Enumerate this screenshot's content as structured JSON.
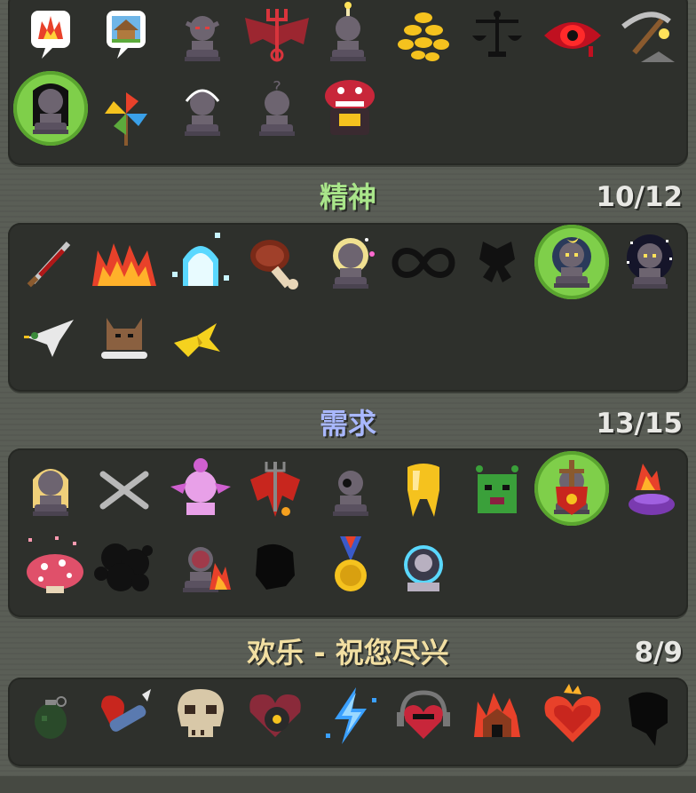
{
  "categories": [
    {
      "title": "",
      "count": "",
      "color": "#ffffff"
    },
    {
      "title": "精神",
      "count": "10/12",
      "color": "#a9e58a"
    },
    {
      "title": "需求",
      "count": "13/15",
      "color": "#a9b8ff"
    },
    {
      "title": "欢乐 - 祝您尽兴",
      "count": "8/9",
      "color": "#f2dfa2"
    }
  ],
  "icons": {
    "row1": [
      "fire-speech-icon",
      "house-speech-icon",
      "statue-demon-icon",
      "devil-wings-trident-icon",
      "statue-candle-icon",
      "gold-coins-icon",
      "scales-icon",
      "red-eye-icon",
      "pickaxe-icon"
    ],
    "row2": [
      "statue-shadow-icon",
      "pinwheel-icon",
      "statue-halo-icon",
      "statue-question-icon",
      "mimic-chest-icon"
    ],
    "row3": [
      "bloody-sword-icon",
      "fire-wall-icon",
      "ghost-ice-icon",
      "meat-leg-icon",
      "statue-blonde-icon",
      "infinity-icon",
      "butterfly-silhouette-icon",
      "statue-moon-icon",
      "statue-stars-icon"
    ],
    "row4": [
      "bird-icon",
      "wolf-bone-icon",
      "banana-peel-icon"
    ],
    "row5": [
      "statue-blonde-woman-icon",
      "crossed-bones-icon",
      "statue-pink-skull-icon",
      "red-dragon-icon",
      "statue-black-eye-icon",
      "golden-tooth-icon",
      "green-goblin-icon",
      "sword-shield-icon",
      "fire-pot-icon"
    ],
    "row6": [
      "red-mushroom-icon",
      "black-smoke-icon",
      "statue-fire-icon",
      "black-shape-icon",
      "gold-medal-icon",
      "astronaut-icon"
    ],
    "row7": [
      "grenade-icon",
      "rocket-heart-icon",
      "skull-icon",
      "bomb-heart-icon",
      "lightning-icon",
      "heart-headphones-icon",
      "burning-house-icon",
      "fire-heart-icon",
      "black-silhouette-icon"
    ]
  }
}
